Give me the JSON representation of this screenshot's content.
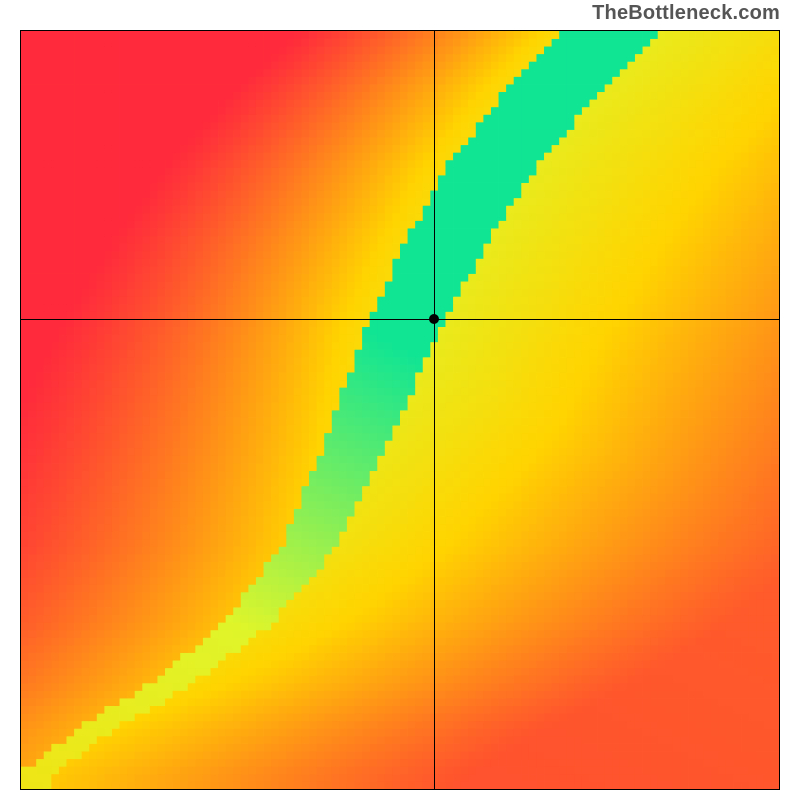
{
  "watermark": "TheBottleneck.com",
  "chart_data": {
    "type": "heatmap",
    "title": "",
    "xlabel": "",
    "ylabel": "",
    "xlim": [
      0,
      1
    ],
    "ylim": [
      0,
      1
    ],
    "crosshair": {
      "x": 0.545,
      "y": 0.62
    },
    "point": {
      "x": 0.545,
      "y": 0.62
    },
    "ridge": {
      "description": "Green optimum band running from bottom-left to top-right with an S-curve",
      "points": [
        {
          "x": 0.02,
          "y": 0.02
        },
        {
          "x": 0.1,
          "y": 0.08
        },
        {
          "x": 0.2,
          "y": 0.14
        },
        {
          "x": 0.3,
          "y": 0.22
        },
        {
          "x": 0.38,
          "y": 0.32
        },
        {
          "x": 0.44,
          "y": 0.45
        },
        {
          "x": 0.5,
          "y": 0.6
        },
        {
          "x": 0.56,
          "y": 0.72
        },
        {
          "x": 0.62,
          "y": 0.82
        },
        {
          "x": 0.7,
          "y": 0.92
        },
        {
          "x": 0.78,
          "y": 1.0
        }
      ]
    },
    "color_scale": [
      {
        "stop": 0.0,
        "color": "#ff2a3c",
        "meaning": "worst"
      },
      {
        "stop": 0.5,
        "color": "#ffd400",
        "meaning": "mid"
      },
      {
        "stop": 0.8,
        "color": "#dff52a",
        "meaning": "near-optimum"
      },
      {
        "stop": 1.0,
        "color": "#10e594",
        "meaning": "optimum"
      }
    ],
    "grid_resolution": 100
  }
}
